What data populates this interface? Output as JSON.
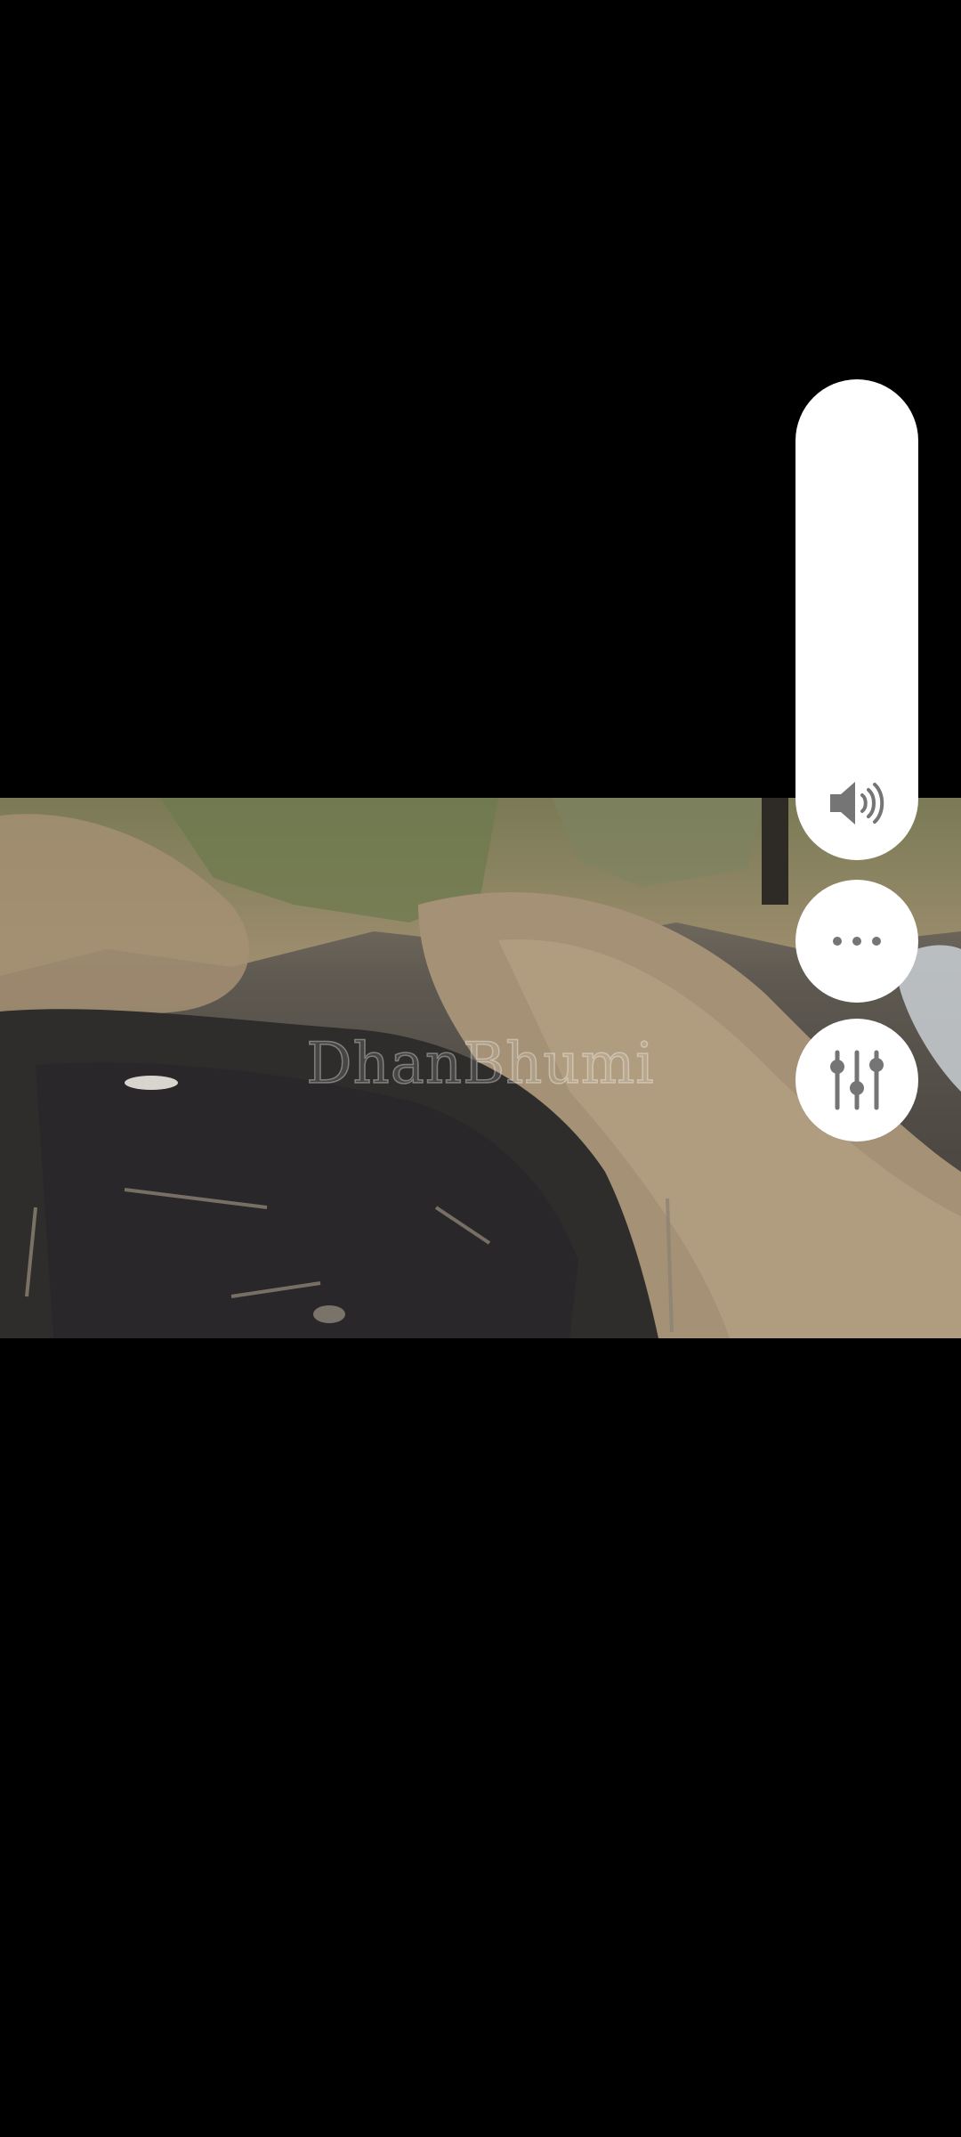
{
  "video": {
    "watermark": "DhanBhumi"
  },
  "controls": {
    "volume_icon": "speaker-volume-icon",
    "more_icon": "more-horizontal-icon",
    "equalizer_icon": "equalizer-sliders-icon",
    "panel_color": "#ffffff",
    "icon_color": "#757575"
  }
}
